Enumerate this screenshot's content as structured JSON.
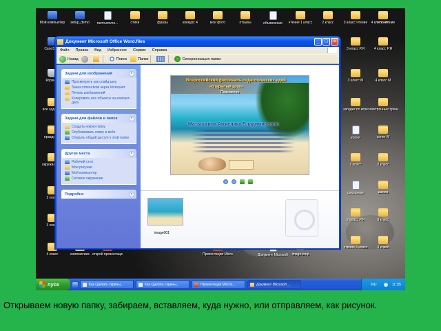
{
  "desktop": {
    "icons": [
      {
        "label": "Мой компьютер",
        "icon": "computer-icon"
      },
      {
        "label": "setup_demo",
        "icon": "setup-icon"
      },
      {
        "label": "razrourovne...",
        "icon": "document-icon"
      },
      {
        "label": "стихи",
        "icon": "folder-icon"
      },
      {
        "label": "фразы",
        "icon": "folder-icon"
      },
      {
        "label": "конкурс 4",
        "icon": "folder-icon"
      },
      {
        "label": "мои фото",
        "icon": "folder-icon"
      },
      {
        "label": "отзывы",
        "icon": "folder-icon"
      },
      {
        "label": "объявление",
        "icon": "document-icon"
      },
      {
        "label": "чтение 1 класс",
        "icon": "folder-icon"
      },
      {
        "label": "2 класс",
        "icon": "folder-icon"
      },
      {
        "label": "3 класс чтение",
        "icon": "folder-icon"
      },
      {
        "label": "4 класс чтение",
        "icon": "folder-icon"
      },
      {
        "label": "CanoScan",
        "icon": "scanner-icon"
      },
      {
        "label": "Корзина",
        "icon": "recycle-bin-icon"
      },
      {
        "label": "все задания",
        "icon": "folder-icon"
      },
      {
        "label": "праздники",
        "icon": "folder-icon"
      },
      {
        "label": "окружающий",
        "icon": "folder-icon"
      },
      {
        "label": "2 класс",
        "icon": "folder-icon"
      },
      {
        "label": "3 класс",
        "icon": "folder-icon"
      },
      {
        "label": "4 класс",
        "icon": "folder-icon"
      },
      {
        "label": "математика",
        "icon": "folder-icon"
      },
      {
        "label": "открой презентацию",
        "icon": "presentation-icon"
      },
      {
        "label": "Презентация Microsoft ...",
        "icon": "presentation-icon"
      },
      {
        "label": "Документ Microsoft ...",
        "icon": "document-icon"
      },
      {
        "label": "image.bmp",
        "icon": "image-icon"
      },
      {
        "label": "3 класс Р.Я",
        "icon": "folder-icon"
      },
      {
        "label": "4 класс Р.Я",
        "icon": "folder-icon"
      },
      {
        "label": "3 класс М",
        "icon": "folder-icon"
      },
      {
        "label": "4 класс М",
        "icon": "folder-icon"
      },
      {
        "label": "загадки по игре",
        "icon": "folder-icon"
      },
      {
        "label": "электронные тренажёры",
        "icon": "folder-icon"
      },
      {
        "label": "копия",
        "icon": "document-icon"
      },
      {
        "label": "сонет М",
        "icon": "folder-icon"
      },
      {
        "label": "1 класс",
        "icon": "folder-icon"
      },
      {
        "label": "2 класс",
        "icon": "folder-icon"
      },
      {
        "label": "школьные",
        "icon": "document-icon"
      },
      {
        "label": "школа",
        "icon": "folder-icon"
      },
      {
        "label": "2 класс Р.Я",
        "icon": "folder-icon"
      },
      {
        "label": "3 класс",
        "icon": "folder-icon"
      },
      {
        "label": "чтение 3 класс",
        "icon": "folder-icon"
      },
      {
        "label": "4 класс",
        "icon": "folder-icon"
      },
      {
        "label": "чтение",
        "icon": "folder-icon"
      }
    ]
  },
  "window": {
    "title": "Документ Microsoft Office Word.files",
    "menu": [
      "Файл",
      "Правка",
      "Вид",
      "Избранное",
      "Сервис",
      "Справка"
    ],
    "toolbar": {
      "back": "Назад",
      "search": "Поиск",
      "folders": "Папки",
      "sync": "Синхронизация папки"
    },
    "panels": [
      {
        "title": "Задачи для изображений",
        "items": [
          "Просмотреть как слайд-шоу",
          "Заказ отпечатков через Интернет",
          "Печать изображений",
          "Копировать все объекты на компакт-диск"
        ]
      },
      {
        "title": "Задачи для файлов и папок",
        "items": [
          "Создать новую папку",
          "Опубликовать папку в вебе",
          "Открыть общий доступ к этой папке"
        ]
      },
      {
        "title": "Другие места",
        "items": [
          "Рабочий стол",
          "Мои рисунки",
          "Мой компьютер",
          "Сетевое окружение"
        ]
      },
      {
        "title": "Подробно",
        "items": []
      }
    ],
    "preview": {
      "line1": "Всероссийский фестиваль педагогических идей",
      "line2": "«Открытый урок»",
      "line3": "Педсовет.ru",
      "name": "Матышкина Анжелика Владимировна"
    },
    "thumbnail_label": "image001"
  },
  "taskbar": {
    "start": "пуск",
    "buttons": [
      "Как сделать скрины...",
      "Как сделать скрины...",
      "Презентация Micros...",
      "Документ Microsoft ..."
    ],
    "lang": "RU",
    "clock": "11:35"
  },
  "caption": "Открываем новую папку, забираем, вставляем, куда нужно, или отправляем, как рисунок."
}
